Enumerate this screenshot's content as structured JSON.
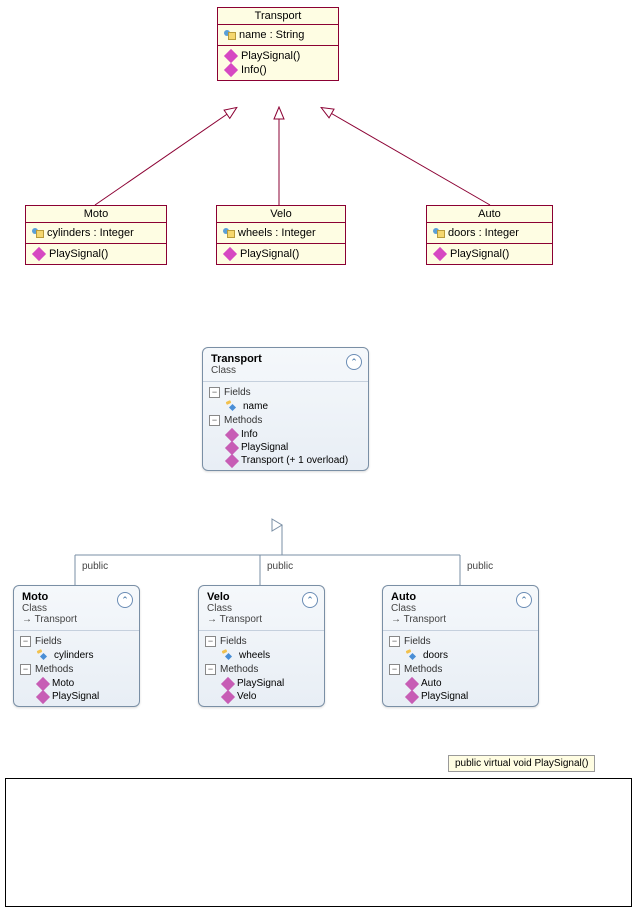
{
  "uml1": {
    "Transport": {
      "name": "Transport",
      "attrs": [
        {
          "text": "name : String"
        }
      ],
      "methods": [
        {
          "text": "PlaySignal()"
        },
        {
          "text": "Info()"
        }
      ]
    },
    "Moto": {
      "name": "Moto",
      "attrs": [
        {
          "text": "cylinders : Integer"
        }
      ],
      "methods": [
        {
          "text": "PlaySignal()"
        }
      ]
    },
    "Velo": {
      "name": "Velo",
      "attrs": [
        {
          "text": "wheels : Integer"
        }
      ],
      "methods": [
        {
          "text": "PlaySignal()"
        }
      ]
    },
    "Auto": {
      "name": "Auto",
      "attrs": [
        {
          "text": "doors : Integer"
        }
      ],
      "methods": [
        {
          "text": "PlaySignal()"
        }
      ]
    }
  },
  "uml2": {
    "access_label": "public",
    "Transport": {
      "name": "Transport",
      "type": "Class",
      "fields_label": "Fields",
      "methods_label": "Methods",
      "fields": [
        {
          "name": "name"
        }
      ],
      "methods": [
        {
          "name": "Info"
        },
        {
          "name": "PlaySignal"
        },
        {
          "name": "Transport (+ 1 overload)"
        }
      ]
    },
    "Moto": {
      "name": "Moto",
      "type": "Class",
      "inherits": "Transport",
      "fields_label": "Fields",
      "methods_label": "Methods",
      "fields": [
        {
          "name": "cylinders"
        }
      ],
      "methods": [
        {
          "name": "Moto"
        },
        {
          "name": "PlaySignal"
        }
      ]
    },
    "Velo": {
      "name": "Velo",
      "type": "Class",
      "inherits": "Transport",
      "fields_label": "Fields",
      "methods_label": "Methods",
      "fields": [
        {
          "name": "wheels"
        }
      ],
      "methods": [
        {
          "name": "PlaySignal"
        },
        {
          "name": "Velo"
        }
      ]
    },
    "Auto": {
      "name": "Auto",
      "type": "Class",
      "inherits": "Transport",
      "fields_label": "Fields",
      "methods_label": "Methods",
      "fields": [
        {
          "name": "doors"
        }
      ],
      "methods": [
        {
          "name": "Auto"
        },
        {
          "name": "PlaySignal"
        }
      ]
    }
  },
  "tooltip": "public virtual void PlaySignal()",
  "inherit_arrow": "→ "
}
